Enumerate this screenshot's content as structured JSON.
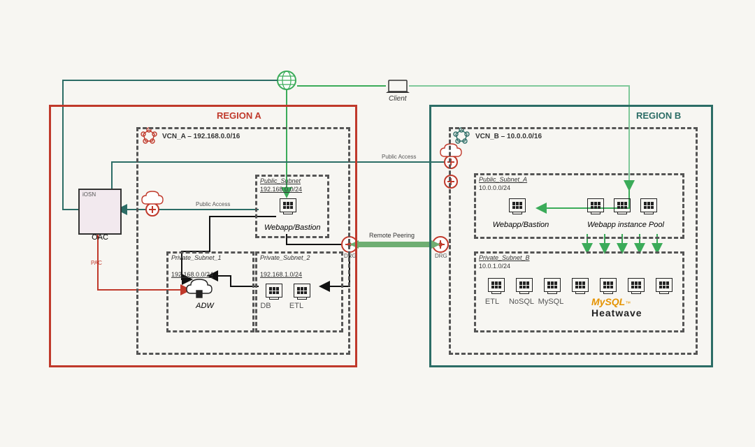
{
  "client": "Client",
  "remote_peering": "Remote Peering",
  "region_a": {
    "title": "REGION A",
    "vcn": {
      "label": "VCN_A – 192.168.0.0/16"
    },
    "public_subnet": {
      "name": "Public_Subnet",
      "cidr": "192.168.0.0/24",
      "host": "Webapp/Bastion"
    },
    "private_subnet_1": {
      "name": "Private_Subnet_1",
      "cidr": "192.168.0.0/24",
      "host": "ADW"
    },
    "private_subnet_2": {
      "name": "Private_Subnet_2",
      "cidr": "192.168.1.0/24",
      "hosts": [
        "DB",
        "ETL"
      ]
    },
    "osn": "OSN",
    "oac": "OAC",
    "public_access": "Public Access",
    "drg": "DRG",
    "pac": "PAC"
  },
  "region_b": {
    "title": "REGION B",
    "vcn": {
      "label": "VCN_B – 10.0.0.0/16"
    },
    "public_subnet": {
      "name": "Public_Subnet_A",
      "cidr": "10.0.0.0/24",
      "host": "Webapp/Bastion",
      "pool": "Webapp instance Pool"
    },
    "private_subnet": {
      "name": "Private_Subnet_B",
      "cidr": "10.0.1.0/24",
      "hosts": [
        "ETL",
        "NoSQL",
        "MySQL"
      ]
    },
    "heatwave": {
      "brand": "MySQL",
      "sub": "Heatwave"
    },
    "public_access": "Public Access",
    "drg": "DRG"
  }
}
